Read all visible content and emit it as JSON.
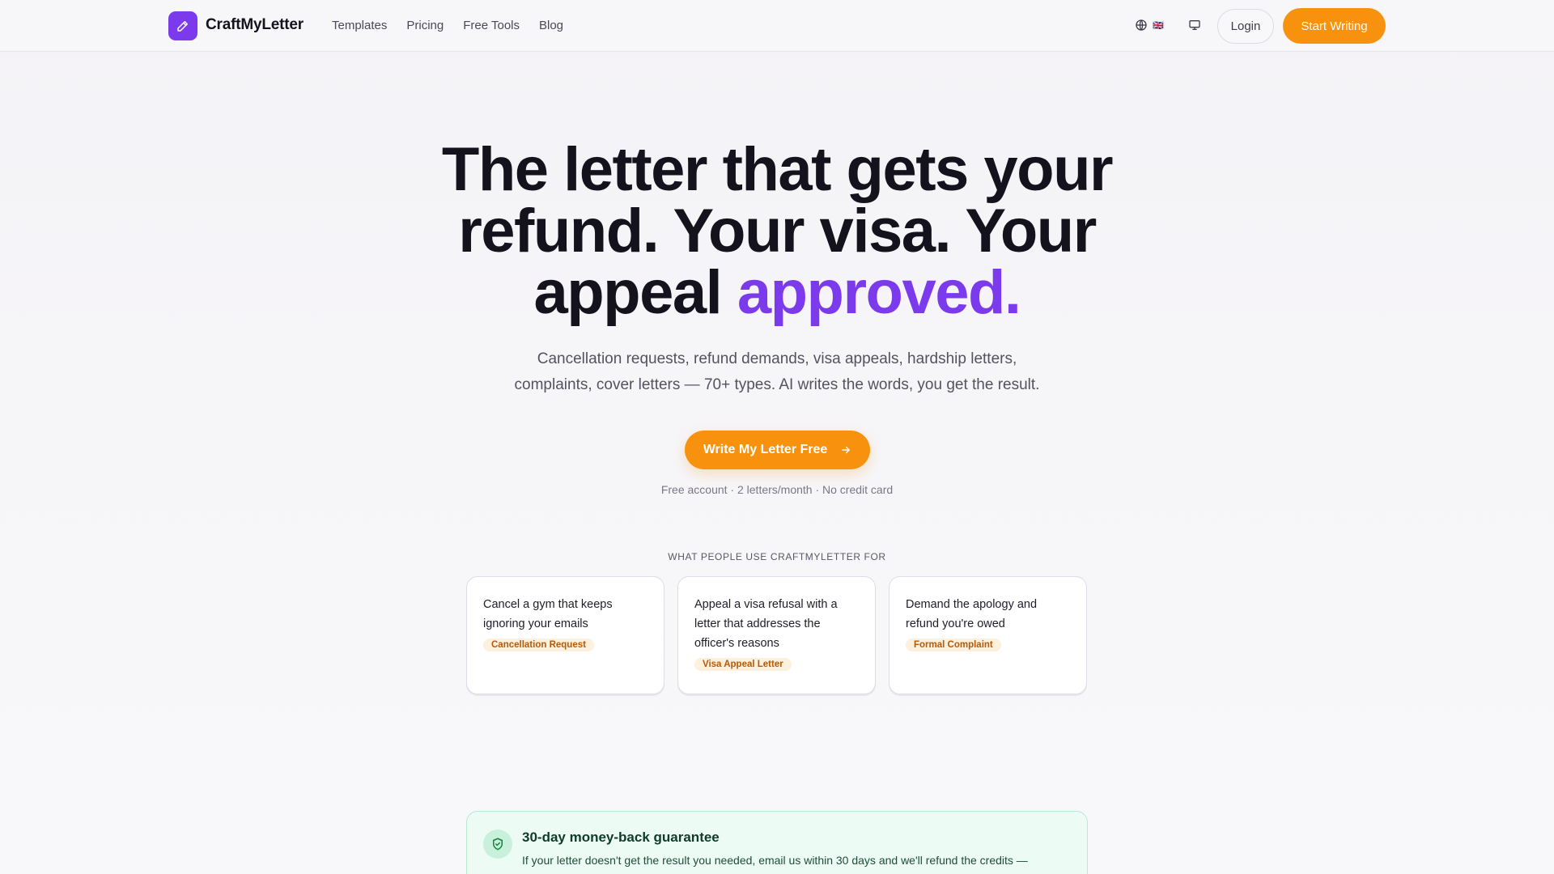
{
  "header": {
    "brand": "CraftMyLetter",
    "nav": [
      "Templates",
      "Pricing",
      "Free Tools",
      "Blog"
    ],
    "language_flag": "🇬🇧",
    "login_label": "Login",
    "start_label": "Start Writing"
  },
  "hero": {
    "title_line1": "The letter that gets your",
    "title_line2": "refund. Your visa. Your",
    "title_line3_plain": "appeal ",
    "title_line3_accent": "approved.",
    "subtitle_line1": "Cancellation requests, refund demands, visa appeals, hardship letters,",
    "subtitle_line2": "complaints, cover letters — 70+ types. AI writes the words, you get the result.",
    "cta_label": "Write My Letter Free",
    "cta_note": "Free account · 2 letters/month · No credit card"
  },
  "uses": {
    "label": "WHAT PEOPLE USE CRAFTMYLETTER FOR",
    "cards": [
      {
        "text": "Cancel a gym that keeps ignoring your emails",
        "tag": "Cancellation Request"
      },
      {
        "text": "Appeal a visa refusal with a letter that addresses the officer's reasons",
        "tag": "Visa Appeal Letter"
      },
      {
        "text": "Demand the apology and refund you're owed",
        "tag": "Formal Complaint"
      }
    ]
  },
  "guarantee": {
    "title": "30-day money-back guarantee",
    "text": "If your letter doesn't get the result you needed, email us within 30 days and we'll refund the credits —"
  },
  "colors": {
    "accent": "#7c3aed",
    "cta": "#f8920e",
    "tag_bg": "#fdf0dc",
    "tag_text": "#b35b0c",
    "guarantee_bg": "#ecfbf3"
  }
}
